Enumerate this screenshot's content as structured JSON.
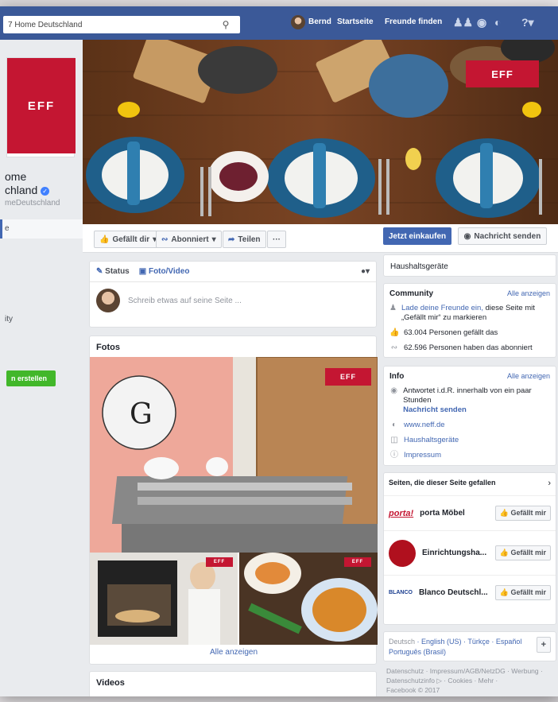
{
  "topbar": {
    "search_value": "7 Home Deutschland",
    "user_name": "Bernd",
    "nav_home": "Startseite",
    "nav_friends": "Freunde finden",
    "icons": [
      "friends-icon",
      "messenger-icon",
      "globe-icon",
      "help-icon"
    ]
  },
  "left": {
    "logo_text": "EFF",
    "page_name_line1": "ome",
    "page_name_line2": "chland",
    "handle": "meDeutschland",
    "nav_selected": "e",
    "nav_item_ity": "ity",
    "create_label": "n erstellen"
  },
  "cover": {
    "badge_text": "EFF"
  },
  "actions": {
    "like": "Gefällt dir",
    "subscribe": "Abonniert",
    "share": "Teilen",
    "more": "···",
    "shop": "Jetzt einkaufen",
    "message": "Nachricht senden"
  },
  "composer": {
    "tab_status": "Status",
    "tab_photo": "Foto/Video",
    "placeholder": "Schreib etwas auf seine Seite ..."
  },
  "photos": {
    "title": "Fotos",
    "logo_badge": "EFF",
    "badge_small": "EFF",
    "see_all": "Alle anzeigen"
  },
  "videos": {
    "title": "Videos"
  },
  "right": {
    "category_header": "Haushaltsgeräte",
    "community": {
      "title": "Community",
      "see_all": "Alle anzeigen",
      "invite_link": "Lade deine Freunde ein,",
      "invite_text": "diese Seite mit „Gefällt mir“ zu markieren",
      "likes": "63.004 Personen gefällt das",
      "follows": "62.596 Personen haben das abonniert"
    },
    "info": {
      "title": "Info",
      "see_all": "Alle anzeigen",
      "response": "Antwortet i.d.R. innerhalb von ein paar Stunden",
      "message_link": "Nachricht senden",
      "website": "www.neff.de",
      "category": "Haushaltsgeräte",
      "imprint": "Impressum"
    },
    "liked_pages": {
      "title": "Seiten, die dieser Seite gefallen",
      "like_label": "Gefällt mir",
      "pages": [
        {
          "name": "porta Möbel",
          "logo": "porta!"
        },
        {
          "name": "Einrichtungsha...",
          "logo": ""
        },
        {
          "name": "Blanco Deutschl...",
          "logo": "BLANCO"
        }
      ]
    },
    "languages": {
      "items": [
        "Deutsch",
        "English (US)",
        "Türkçe",
        "Español",
        "Português (Brasil)"
      ],
      "sep": " · ",
      "add": "+"
    },
    "footer": {
      "line1": "Datenschutz · Impressum/AGB/NetzDG · Werbung ·",
      "line2": "Datenschutzinfo ▷ · Cookies · Mehr ·",
      "line3": "Facebook © 2017"
    }
  },
  "colors": {
    "fb_blue": "#3b5998",
    "neff_red": "#c41632",
    "link": "#4267b2"
  }
}
